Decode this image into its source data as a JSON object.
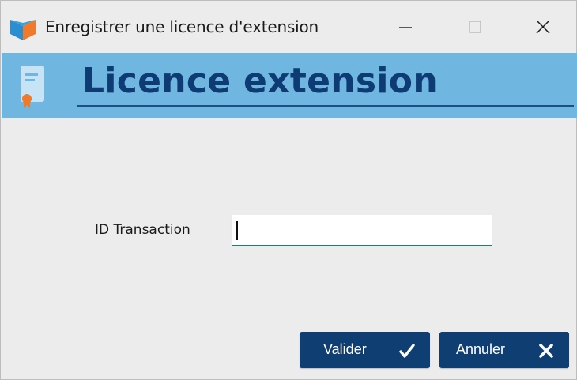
{
  "window": {
    "title": "Enregistrer une licence d'extension",
    "controls": {
      "minimize_icon": "minimize-icon",
      "maximize_icon": "maximize-icon",
      "close_icon": "close-icon"
    }
  },
  "header": {
    "title": "Licence extension",
    "icon": "license-document-icon",
    "background_color": "#6fb7e0",
    "title_color": "#0e3b73"
  },
  "form": {
    "transaction_label": "ID Transaction",
    "transaction_value": "",
    "transaction_placeholder": ""
  },
  "buttons": {
    "ok_label": "Valider",
    "ok_icon": "checkmark-icon",
    "cancel_label": "Annuler",
    "cancel_icon": "close-x-icon",
    "color": "#0f3f72"
  }
}
